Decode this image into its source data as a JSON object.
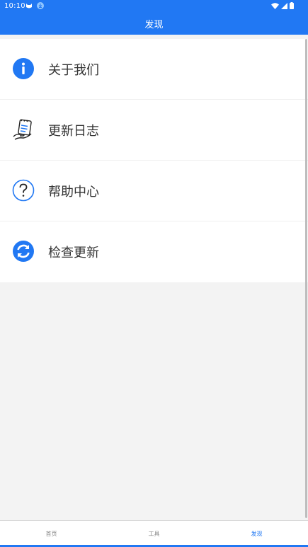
{
  "status_bar": {
    "time": "10:10",
    "icons": [
      "cat-notification-icon",
      "download-icon",
      "wifi-icon",
      "signal-icon",
      "battery-icon"
    ]
  },
  "app_bar": {
    "title": "发现"
  },
  "menu": {
    "items": [
      {
        "label": "关于我们",
        "icon": "info-icon"
      },
      {
        "label": "更新日志",
        "icon": "changelog-icon"
      },
      {
        "label": "帮助中心",
        "icon": "help-icon"
      },
      {
        "label": "检查更新",
        "icon": "refresh-icon"
      }
    ]
  },
  "bottom_nav": {
    "items": [
      {
        "label": "首页"
      },
      {
        "label": "工具"
      },
      {
        "label": "发现",
        "active": true
      }
    ]
  },
  "colors": {
    "accent": "#2178f3",
    "background": "#f3f3f3"
  }
}
